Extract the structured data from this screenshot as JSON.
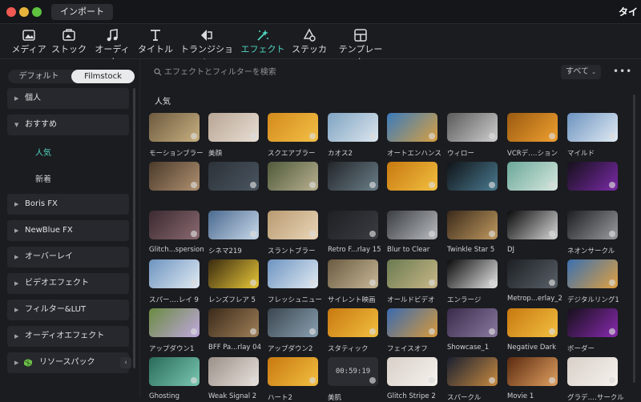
{
  "titlebar": {
    "tab": "インポート",
    "right_text": "タイ"
  },
  "toolbar": {
    "items": [
      {
        "label": "メディア",
        "icon": "media-icon"
      },
      {
        "label": "ストック",
        "icon": "stock-icon"
      },
      {
        "label": "オーディオ",
        "icon": "music-icon"
      },
      {
        "label": "タイトル",
        "icon": "title-icon"
      },
      {
        "label": "トランジション",
        "icon": "transition-icon"
      },
      {
        "label": "エフェクト",
        "icon": "effects-icon",
        "active": true
      },
      {
        "label": "ステッカー",
        "icon": "sticker-icon"
      },
      {
        "label": "テンプレート",
        "icon": "template-icon"
      }
    ]
  },
  "sidebar": {
    "segments": [
      "デフォルト",
      "Filmstock"
    ],
    "categories": [
      "個人",
      "おすすめ",
      "Boris FX",
      "NewBlue FX",
      "オーバーレイ",
      "ビデオエフェクト",
      "フィルター&LUT",
      "オーディオエフェクト",
      "リソースパック"
    ],
    "subitems": [
      "人気",
      "新着"
    ]
  },
  "main": {
    "search_placeholder": "エフェクトとフィルターを検索",
    "filter": "すべて",
    "section": "人気",
    "timecode": "00:59:19"
  },
  "items": [
    {
      "label": "モーションブラー",
      "c1": "#6d5a40",
      "c2": "#c8b080"
    },
    {
      "label": "美顔",
      "c1": "#b8a594",
      "c2": "#e8dfd4"
    },
    {
      "label": "スクエアブラー",
      "c1": "#d48a1c",
      "c2": "#f2c046"
    },
    {
      "label": "カオス2",
      "c1": "#7fa3c2",
      "c2": "#dce6ee"
    },
    {
      "label": "オートエンハンス",
      "c1": "#3a7bbd",
      "c2": "#d9a040"
    },
    {
      "label": "ウィロー",
      "c1": "#5a5a5a",
      "c2": "#cfcfcf"
    },
    {
      "label": "VCRデ‥‥ション",
      "c1": "#9a5a10",
      "c2": "#f0a030"
    },
    {
      "label": "マイルド",
      "c1": "#6d93c0",
      "c2": "#e1ebf3"
    },
    {
      "label": "",
      "c1": "#4a3a2a",
      "c2": "#b09070"
    },
    {
      "label": "",
      "c1": "#2c3238",
      "c2": "#4a5560"
    },
    {
      "label": "",
      "c1": "#4f5a3a",
      "c2": "#b8b090"
    },
    {
      "label": "",
      "c1": "#23262a",
      "c2": "#6a7e88"
    },
    {
      "label": "",
      "c1": "#c87810",
      "c2": "#f2c040"
    },
    {
      "label": "",
      "c1": "#101418",
      "c2": "#4a7a90"
    },
    {
      "label": "",
      "c1": "#6aa898",
      "c2": "#d8e8e0"
    },
    {
      "label": "",
      "c1": "#15101a",
      "c2": "#7a2aa8"
    },
    {
      "label": "Glitch...spersion",
      "c1": "#3a2a30",
      "c2": "#8a6a70"
    },
    {
      "label": "シネマ219",
      "c1": "#4a6a90",
      "c2": "#c8d8e8"
    },
    {
      "label": "スラントブラー",
      "c1": "#b89a70",
      "c2": "#ead6b8"
    },
    {
      "label": "Retro F...rlay 15",
      "c1": "#1e2024",
      "c2": "#3a3c42"
    },
    {
      "label": "Blur to Clear",
      "c1": "#3a3d42",
      "c2": "#b9bcc0"
    },
    {
      "label": "Twinkle Star 5",
      "c1": "#3a2a1a",
      "c2": "#c09a60"
    },
    {
      "label": "DJ",
      "c1": "#0a0a0a",
      "c2": "#d8d8d8"
    },
    {
      "label": "ネオンサークル",
      "c1": "#1c1e22",
      "c2": "#9a9ca0"
    },
    {
      "label": "スパー‥‥レイ 9",
      "c1": "#6d93c0",
      "c2": "#e1ebf3"
    },
    {
      "label": "レンズフレア 5",
      "c1": "#3a2a10",
      "c2": "#e8c838"
    },
    {
      "label": "フレッシュニュー",
      "c1": "#6d93c0",
      "c2": "#e1ebf3"
    },
    {
      "label": "サイレント映画",
      "c1": "#6a5a40",
      "c2": "#c8b898"
    },
    {
      "label": "オールドビデオ",
      "c1": "#6a7a50",
      "c2": "#c8b888"
    },
    {
      "label": "エンラージ",
      "c1": "#0a0a0a",
      "c2": "#e8e8e8"
    },
    {
      "label": "Metrop...erlay_2",
      "c1": "#1c2024",
      "c2": "#5a6068"
    },
    {
      "label": "デジタルリング1",
      "c1": "#3a70b0",
      "c2": "#e0a040"
    },
    {
      "label": "アップダウン1",
      "c1": "#6a8a40",
      "c2": "#c0a8e0"
    },
    {
      "label": "BFF Pa...rlay 04",
      "c1": "#3a2a1a",
      "c2": "#a08058"
    },
    {
      "label": "アップダウン2",
      "c1": "#3a4650",
      "c2": "#8aa0b0"
    },
    {
      "label": "スタティック",
      "c1": "#c87810",
      "c2": "#f2c040"
    },
    {
      "label": "フェイスオフ",
      "c1": "#3a6ab0",
      "c2": "#d89a3a"
    },
    {
      "label": "Showcase_1",
      "c1": "#3a2a4a",
      "c2": "#8a7aa0"
    },
    {
      "label": "Negative Dark",
      "c1": "#c87810",
      "c2": "#f2c040"
    },
    {
      "label": "ボーダー",
      "c1": "#15101a",
      "c2": "#8a2ab0"
    },
    {
      "label": "Ghosting",
      "c1": "#2a6a5a",
      "c2": "#7ac8b0"
    },
    {
      "label": "Weak Signal 2",
      "c1": "#9a9088",
      "c2": "#e8e2dc"
    },
    {
      "label": "ハート2",
      "c1": "#c87810",
      "c2": "#f2c040"
    },
    {
      "label": "美肌",
      "c1": "#2b2d32",
      "c2": "#2b2d32"
    },
    {
      "label": "Glitch Stripe 2",
      "c1": "#d8d0c8",
      "c2": "#f6f2ee"
    },
    {
      "label": "スパークル",
      "c1": "#1a2030",
      "c2": "#c88a40"
    },
    {
      "label": "Movie 1",
      "c1": "#5a2a10",
      "c2": "#e0a060"
    },
    {
      "label": "グラデ‥‥サークル",
      "c1": "#d8d0c8",
      "c2": "#f6f2ee"
    }
  ]
}
